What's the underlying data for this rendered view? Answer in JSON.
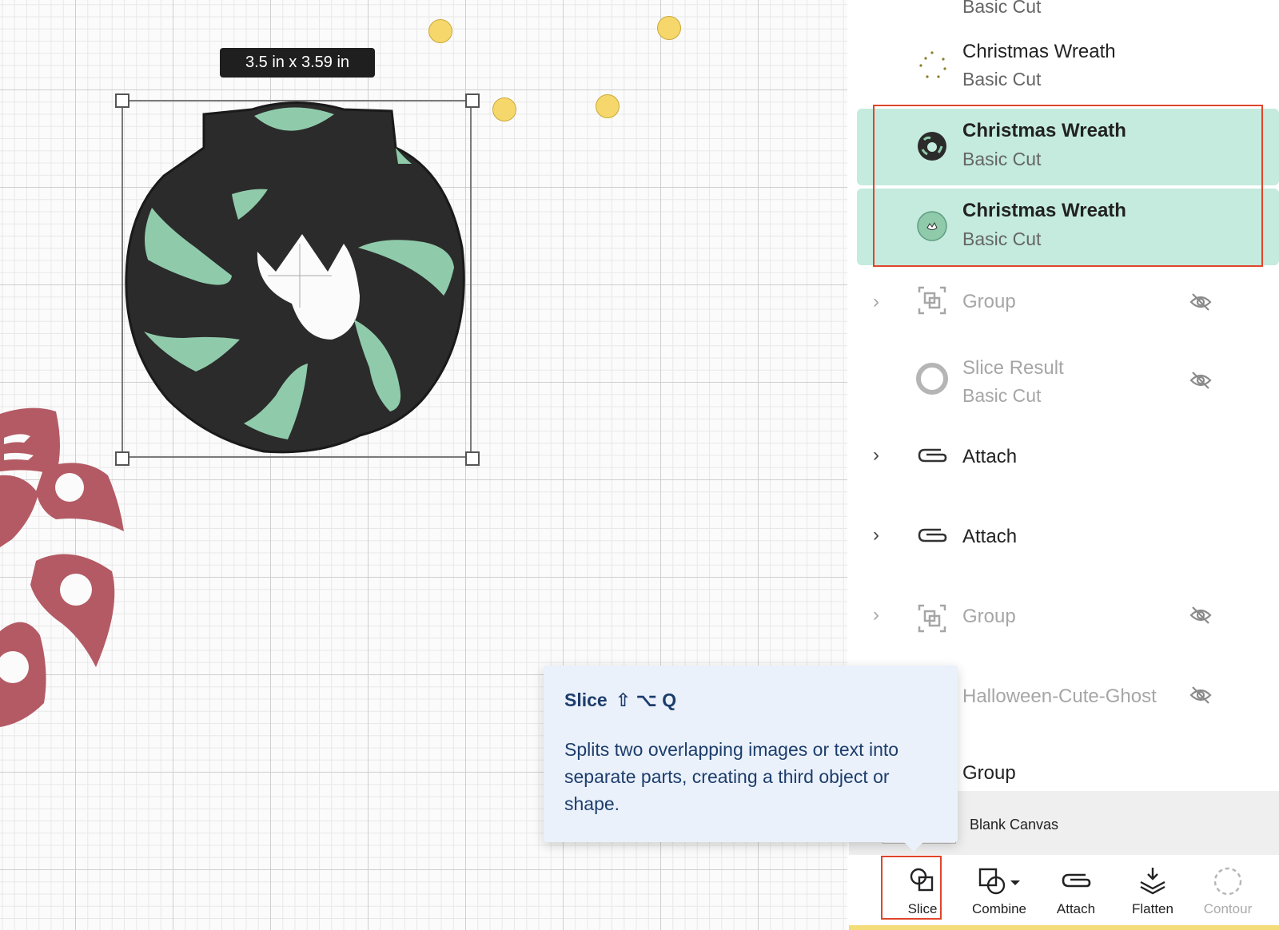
{
  "canvas": {
    "size_label": "3.5  in x 3.59  in",
    "colors": {
      "wreath_dark": "#2b2b2b",
      "wreath_green": "#8fcbab",
      "bow_red": "#b45a64",
      "dot_yellow": "#f6d76b"
    }
  },
  "layers": {
    "items": [
      {
        "title": "",
        "sub": "Basic Cut"
      },
      {
        "title": "Christmas Wreath",
        "sub": "Basic Cut"
      },
      {
        "title": "Christmas Wreath",
        "sub": "Basic Cut",
        "selected": true
      },
      {
        "title": "Christmas Wreath",
        "sub": "Basic Cut",
        "selected": true
      },
      {
        "title": "Group",
        "hidden": true
      },
      {
        "title": "Slice Result",
        "sub": "Basic Cut",
        "hidden": true
      },
      {
        "title": "Attach"
      },
      {
        "title": "Attach"
      },
      {
        "title": "Group",
        "hidden": true
      },
      {
        "title": "Halloween-Cute-Ghost",
        "hidden": true
      },
      {
        "title": "Group"
      }
    ]
  },
  "canvas_row": {
    "label": "Blank Canvas"
  },
  "toolbar": {
    "slice": "Slice",
    "combine": "Combine",
    "attach": "Attach",
    "flatten": "Flatten",
    "contour": "Contour"
  },
  "tooltip": {
    "title": "Slice",
    "shortcut": "⇧ ⌥ Q",
    "body": "Splits two overlapping images or text into separate parts, creating a third object or shape."
  },
  "colors": {
    "selected_bg": "#c4ebdd",
    "highlight_outline": "#e0452b",
    "tooltip_bg": "#eaf1fb",
    "tooltip_text": "#1d3d6b"
  }
}
